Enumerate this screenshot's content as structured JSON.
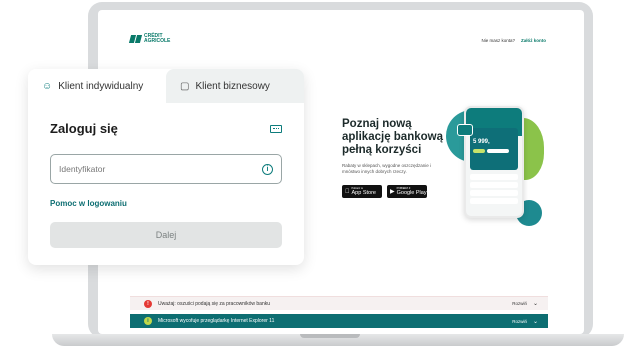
{
  "header": {
    "logo_line1": "CRÉDIT",
    "logo_line2": "AGRICOLE",
    "no_account": "Nie masz konta?",
    "open_account": "Załóż konto"
  },
  "login": {
    "tabs": [
      {
        "label": "Klient indywidualny",
        "icon": "person-icon"
      },
      {
        "label": "Klient biznesowy",
        "icon": "briefcase-icon"
      }
    ],
    "title": "Zaloguj się",
    "id_placeholder": "Identyfikator",
    "help_link": "Pomoc w logowaniu",
    "next_button": "Dalej"
  },
  "promo": {
    "title": "Poznaj nową aplikację bankową pełną korzyści",
    "description": "Rabaty w sklepach, wygodne oszczędzanie i mnóstwo innych dobrych rzeczy.",
    "app_store_small": "Pobierz w",
    "app_store": "App Store",
    "google_play_small": "POBIERZ Z",
    "google_play": "Google Play"
  },
  "phone": {
    "balance": "5 999,"
  },
  "notices": [
    {
      "badge": "!",
      "text": "Uważaj: oszuści podają się za pracowników banku",
      "expand": "Rozwiń"
    },
    {
      "badge": "i",
      "text": "Microsoft wycofuje przeglądarkę Internet Explorer 11",
      "expand": "Rozwiń"
    }
  ],
  "colors": {
    "brand": "#0d7c7c",
    "accent_green": "#8bc34a",
    "alert_red": "#e53935"
  }
}
